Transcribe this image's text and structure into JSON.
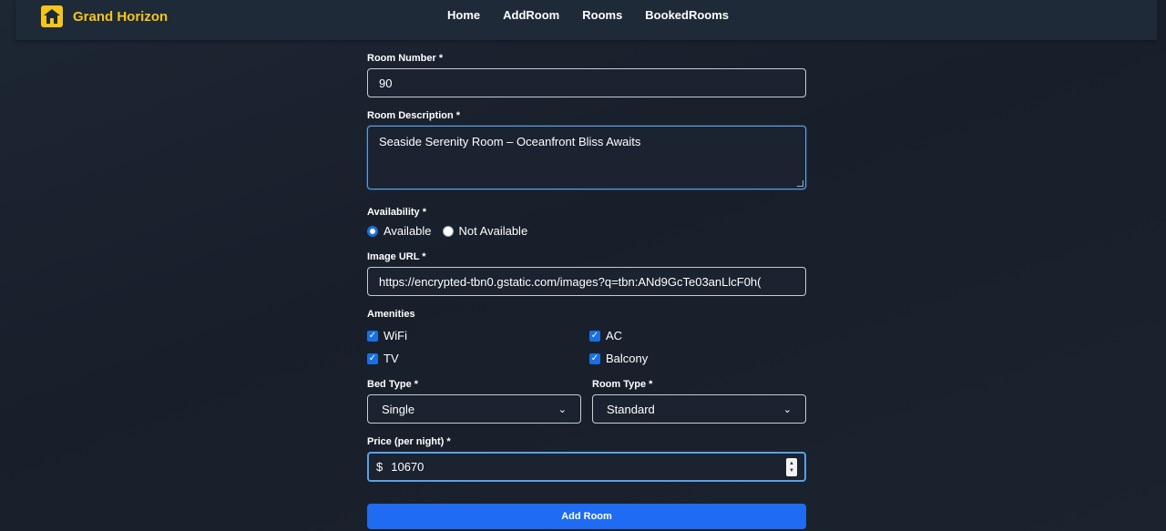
{
  "brand": {
    "name": "Grand Horizon",
    "icon": "house-icon",
    "color": "#f5c518"
  },
  "nav": {
    "links": [
      "Home",
      "AddRoom",
      "Rooms",
      "BookedRooms"
    ]
  },
  "form": {
    "room_number": {
      "label": "Room Number *",
      "value": "90"
    },
    "room_description": {
      "label": "Room Description *",
      "value": "Seaside Serenity Room – Oceanfront Bliss Awaits"
    },
    "availability": {
      "label": "Availability *",
      "options": [
        "Available",
        "Not Available"
      ],
      "selected": "Available"
    },
    "image_url": {
      "label": "Image URL *",
      "value": "https://encrypted-tbn0.gstatic.com/images?q=tbn:ANd9GcTe03anLlcF0h("
    },
    "amenities": {
      "label": "Amenities",
      "items": [
        {
          "label": "WiFi",
          "checked": true
        },
        {
          "label": "AC",
          "checked": true
        },
        {
          "label": "TV",
          "checked": true
        },
        {
          "label": "Balcony",
          "checked": true
        }
      ]
    },
    "bed_type": {
      "label": "Bed Type *",
      "value": "Single"
    },
    "room_type": {
      "label": "Room Type *",
      "value": "Standard"
    },
    "price": {
      "label": "Price (per night) *",
      "currency": "$",
      "value": "10670"
    },
    "submit_label": "Add Room"
  },
  "colors": {
    "accent": "#1f6bf2",
    "background": "#1b2230",
    "brand": "#f5c518"
  }
}
